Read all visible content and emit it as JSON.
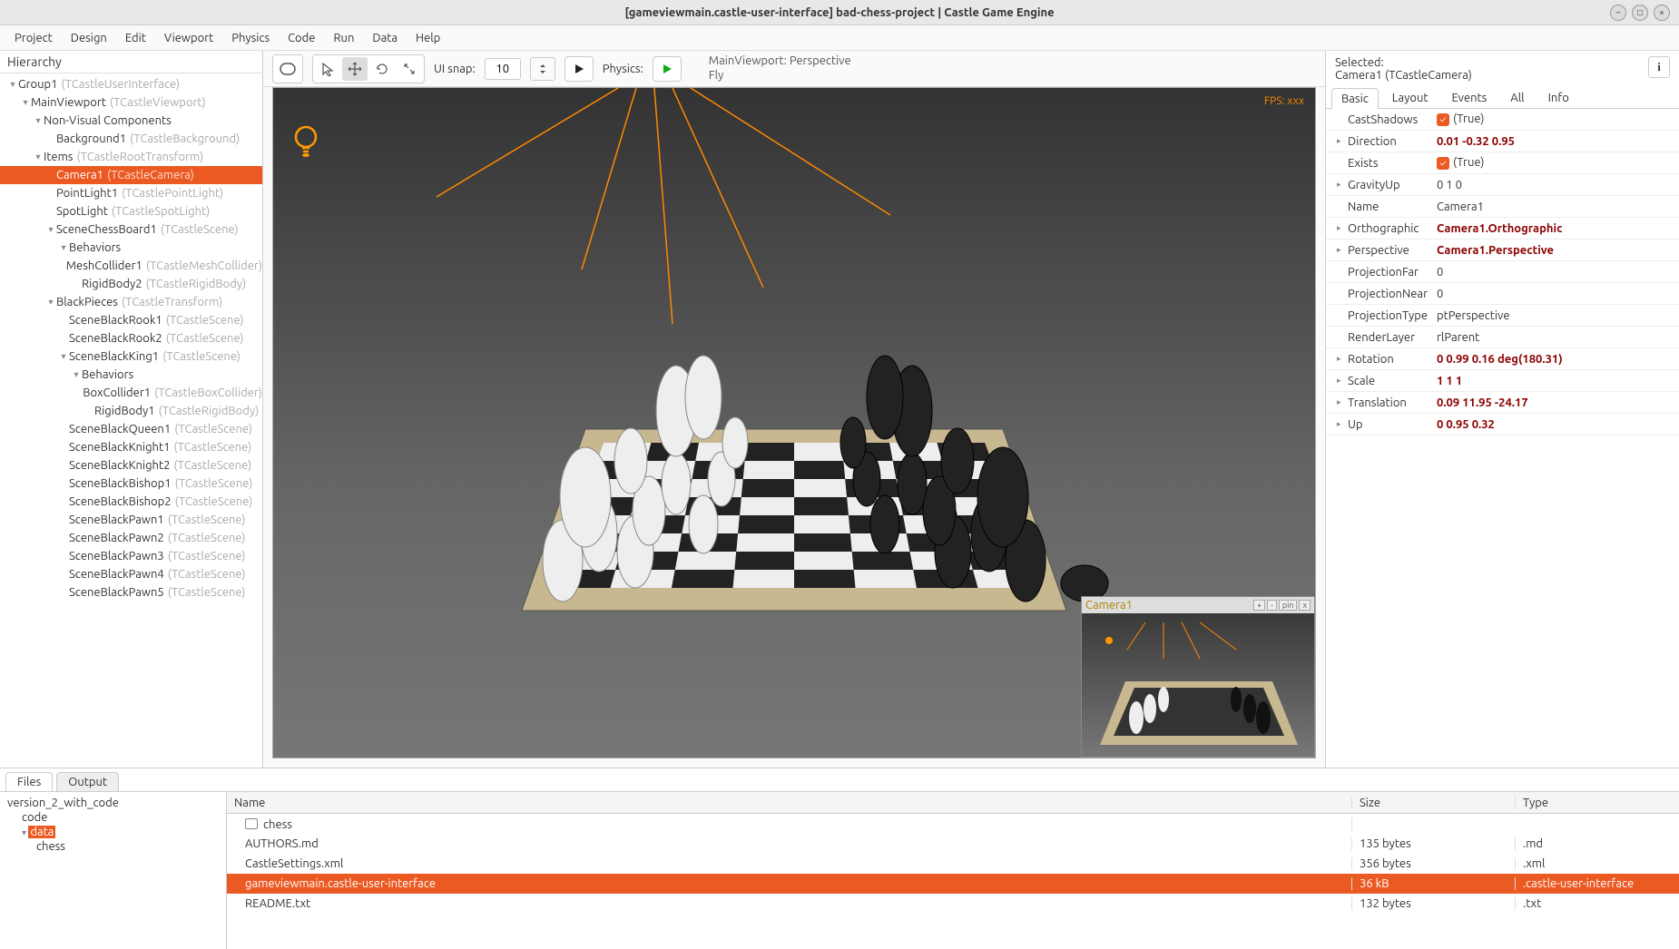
{
  "window": {
    "title": "[gameviewmain.castle-user-interface] bad-chess-project | Castle Game Engine"
  },
  "menubar": [
    "Project",
    "Design",
    "Edit",
    "Viewport",
    "Physics",
    "Code",
    "Run",
    "Data",
    "Help"
  ],
  "hierarchy": {
    "title": "Hierarchy",
    "items": [
      {
        "indent": 0,
        "arrow": "▾",
        "label": "Group1",
        "type": "(TCastleUserInterface)",
        "sel": false
      },
      {
        "indent": 1,
        "arrow": "▾",
        "label": "MainViewport",
        "type": "(TCastleViewport)",
        "sel": false
      },
      {
        "indent": 2,
        "arrow": "▾",
        "label": "Non-Visual Components",
        "type": "",
        "sel": false
      },
      {
        "indent": 3,
        "arrow": "",
        "label": "Background1",
        "type": "(TCastleBackground)",
        "sel": false
      },
      {
        "indent": 2,
        "arrow": "▾",
        "label": "Items",
        "type": "(TCastleRootTransform)",
        "sel": false
      },
      {
        "indent": 3,
        "arrow": "",
        "label": "Camera1",
        "type": "(TCastleCamera)",
        "sel": true
      },
      {
        "indent": 3,
        "arrow": "",
        "label": "PointLight1",
        "type": "(TCastlePointLight)",
        "sel": false
      },
      {
        "indent": 3,
        "arrow": "",
        "label": "SpotLight",
        "type": "(TCastleSpotLight)",
        "sel": false
      },
      {
        "indent": 3,
        "arrow": "▾",
        "label": "SceneChessBoard1",
        "type": "(TCastleScene)",
        "sel": false
      },
      {
        "indent": 4,
        "arrow": "▾",
        "label": "Behaviors",
        "type": "",
        "sel": false
      },
      {
        "indent": 5,
        "arrow": "",
        "label": "MeshCollider1",
        "type": "(TCastleMeshCollider)",
        "sel": false
      },
      {
        "indent": 5,
        "arrow": "",
        "label": "RigidBody2",
        "type": "(TCastleRigidBody)",
        "sel": false
      },
      {
        "indent": 3,
        "arrow": "▾",
        "label": "BlackPieces",
        "type": "(TCastleTransform)",
        "sel": false
      },
      {
        "indent": 4,
        "arrow": "",
        "label": "SceneBlackRook1",
        "type": "(TCastleScene)",
        "sel": false
      },
      {
        "indent": 4,
        "arrow": "",
        "label": "SceneBlackRook2",
        "type": "(TCastleScene)",
        "sel": false
      },
      {
        "indent": 4,
        "arrow": "▾",
        "label": "SceneBlackKing1",
        "type": "(TCastleScene)",
        "sel": false
      },
      {
        "indent": 5,
        "arrow": "▾",
        "label": "Behaviors",
        "type": "",
        "sel": false
      },
      {
        "indent": 6,
        "arrow": "",
        "label": "BoxCollider1",
        "type": "(TCastleBoxCollider)",
        "sel": false
      },
      {
        "indent": 6,
        "arrow": "",
        "label": "RigidBody1",
        "type": "(TCastleRigidBody)",
        "sel": false
      },
      {
        "indent": 4,
        "arrow": "",
        "label": "SceneBlackQueen1",
        "type": "(TCastleScene)",
        "sel": false
      },
      {
        "indent": 4,
        "arrow": "",
        "label": "SceneBlackKnight1",
        "type": "(TCastleScene)",
        "sel": false
      },
      {
        "indent": 4,
        "arrow": "",
        "label": "SceneBlackKnight2",
        "type": "(TCastleScene)",
        "sel": false
      },
      {
        "indent": 4,
        "arrow": "",
        "label": "SceneBlackBishop1",
        "type": "(TCastleScene)",
        "sel": false
      },
      {
        "indent": 4,
        "arrow": "",
        "label": "SceneBlackBishop2",
        "type": "(TCastleScene)",
        "sel": false
      },
      {
        "indent": 4,
        "arrow": "",
        "label": "SceneBlackPawn1",
        "type": "(TCastleScene)",
        "sel": false
      },
      {
        "indent": 4,
        "arrow": "",
        "label": "SceneBlackPawn2",
        "type": "(TCastleScene)",
        "sel": false
      },
      {
        "indent": 4,
        "arrow": "",
        "label": "SceneBlackPawn3",
        "type": "(TCastleScene)",
        "sel": false
      },
      {
        "indent": 4,
        "arrow": "",
        "label": "SceneBlackPawn4",
        "type": "(TCastleScene)",
        "sel": false
      },
      {
        "indent": 4,
        "arrow": "",
        "label": "SceneBlackPawn5",
        "type": "(TCastleScene)",
        "sel": false
      }
    ]
  },
  "toolbar": {
    "snap_label": "UI snap:",
    "snap_value": "10",
    "physics_label": "Physics:",
    "viewport_info_l1": "MainViewport: Perspective",
    "viewport_info_l2": "Fly"
  },
  "viewport": {
    "fps": "FPS: xxx",
    "camera_preview": {
      "title": "Camera1",
      "buttons": [
        "+",
        "-",
        "pin",
        "x"
      ]
    }
  },
  "inspector": {
    "selected_label": "Selected:",
    "selected_value": "Camera1 (TCastleCamera)",
    "tabs": [
      "Basic",
      "Layout",
      "Events",
      "All",
      "Info"
    ],
    "active_tab": "Basic",
    "props": [
      {
        "arrow": "",
        "name": "CastShadows",
        "val": "(True)",
        "bold": false,
        "check": true
      },
      {
        "arrow": "▸",
        "name": "Direction",
        "val": "0.01 -0.32 0.95",
        "bold": true,
        "check": false
      },
      {
        "arrow": "",
        "name": "Exists",
        "val": "(True)",
        "bold": false,
        "check": true
      },
      {
        "arrow": "▸",
        "name": "GravityUp",
        "val": "0 1 0",
        "bold": false,
        "check": false
      },
      {
        "arrow": "",
        "name": "Name",
        "val": "Camera1",
        "bold": false,
        "check": false
      },
      {
        "arrow": "▸",
        "name": "Orthographic",
        "val": "Camera1.Orthographic",
        "bold": true,
        "check": false
      },
      {
        "arrow": "▸",
        "name": "Perspective",
        "val": "Camera1.Perspective",
        "bold": true,
        "check": false
      },
      {
        "arrow": "",
        "name": "ProjectionFar",
        "val": "0",
        "bold": false,
        "check": false
      },
      {
        "arrow": "",
        "name": "ProjectionNear",
        "val": "0",
        "bold": false,
        "check": false
      },
      {
        "arrow": "",
        "name": "ProjectionType",
        "val": "ptPerspective",
        "bold": false,
        "check": false
      },
      {
        "arrow": "",
        "name": "RenderLayer",
        "val": "rlParent",
        "bold": false,
        "check": false
      },
      {
        "arrow": "▸",
        "name": "Rotation",
        "val": "0 0.99 0.16 deg(180.31)",
        "bold": true,
        "check": false
      },
      {
        "arrow": "▸",
        "name": "Scale",
        "val": "1 1 1",
        "bold": true,
        "check": false
      },
      {
        "arrow": "▸",
        "name": "Translation",
        "val": "0.09 11.95 -24.17",
        "bold": true,
        "check": false
      },
      {
        "arrow": "▸",
        "name": "Up",
        "val": "0 0.95 0.32",
        "bold": true,
        "check": false
      }
    ]
  },
  "bottom": {
    "tabs": [
      "Files",
      "Output"
    ],
    "active_tab": "Files",
    "tree": [
      {
        "indent": 0,
        "label": "version_2_with_code",
        "hl": false
      },
      {
        "indent": 1,
        "label": "code",
        "hl": false
      },
      {
        "indent": 1,
        "label": "data",
        "hl": true,
        "arrow": "▾"
      },
      {
        "indent": 2,
        "label": "chess",
        "hl": false
      }
    ],
    "headers": {
      "name": "Name",
      "size": "Size",
      "type": "Type"
    },
    "files": [
      {
        "name": "chess",
        "size": "",
        "type": "",
        "folder": true,
        "sel": false
      },
      {
        "name": "AUTHORS.md",
        "size": "135 bytes",
        "type": ".md",
        "folder": false,
        "sel": false
      },
      {
        "name": "CastleSettings.xml",
        "size": "356 bytes",
        "type": ".xml",
        "folder": false,
        "sel": false
      },
      {
        "name": "gameviewmain.castle-user-interface",
        "size": "36 kB",
        "type": ".castle-user-interface",
        "folder": false,
        "sel": true
      },
      {
        "name": "README.txt",
        "size": "132 bytes",
        "type": ".txt",
        "folder": false,
        "sel": false
      }
    ]
  }
}
